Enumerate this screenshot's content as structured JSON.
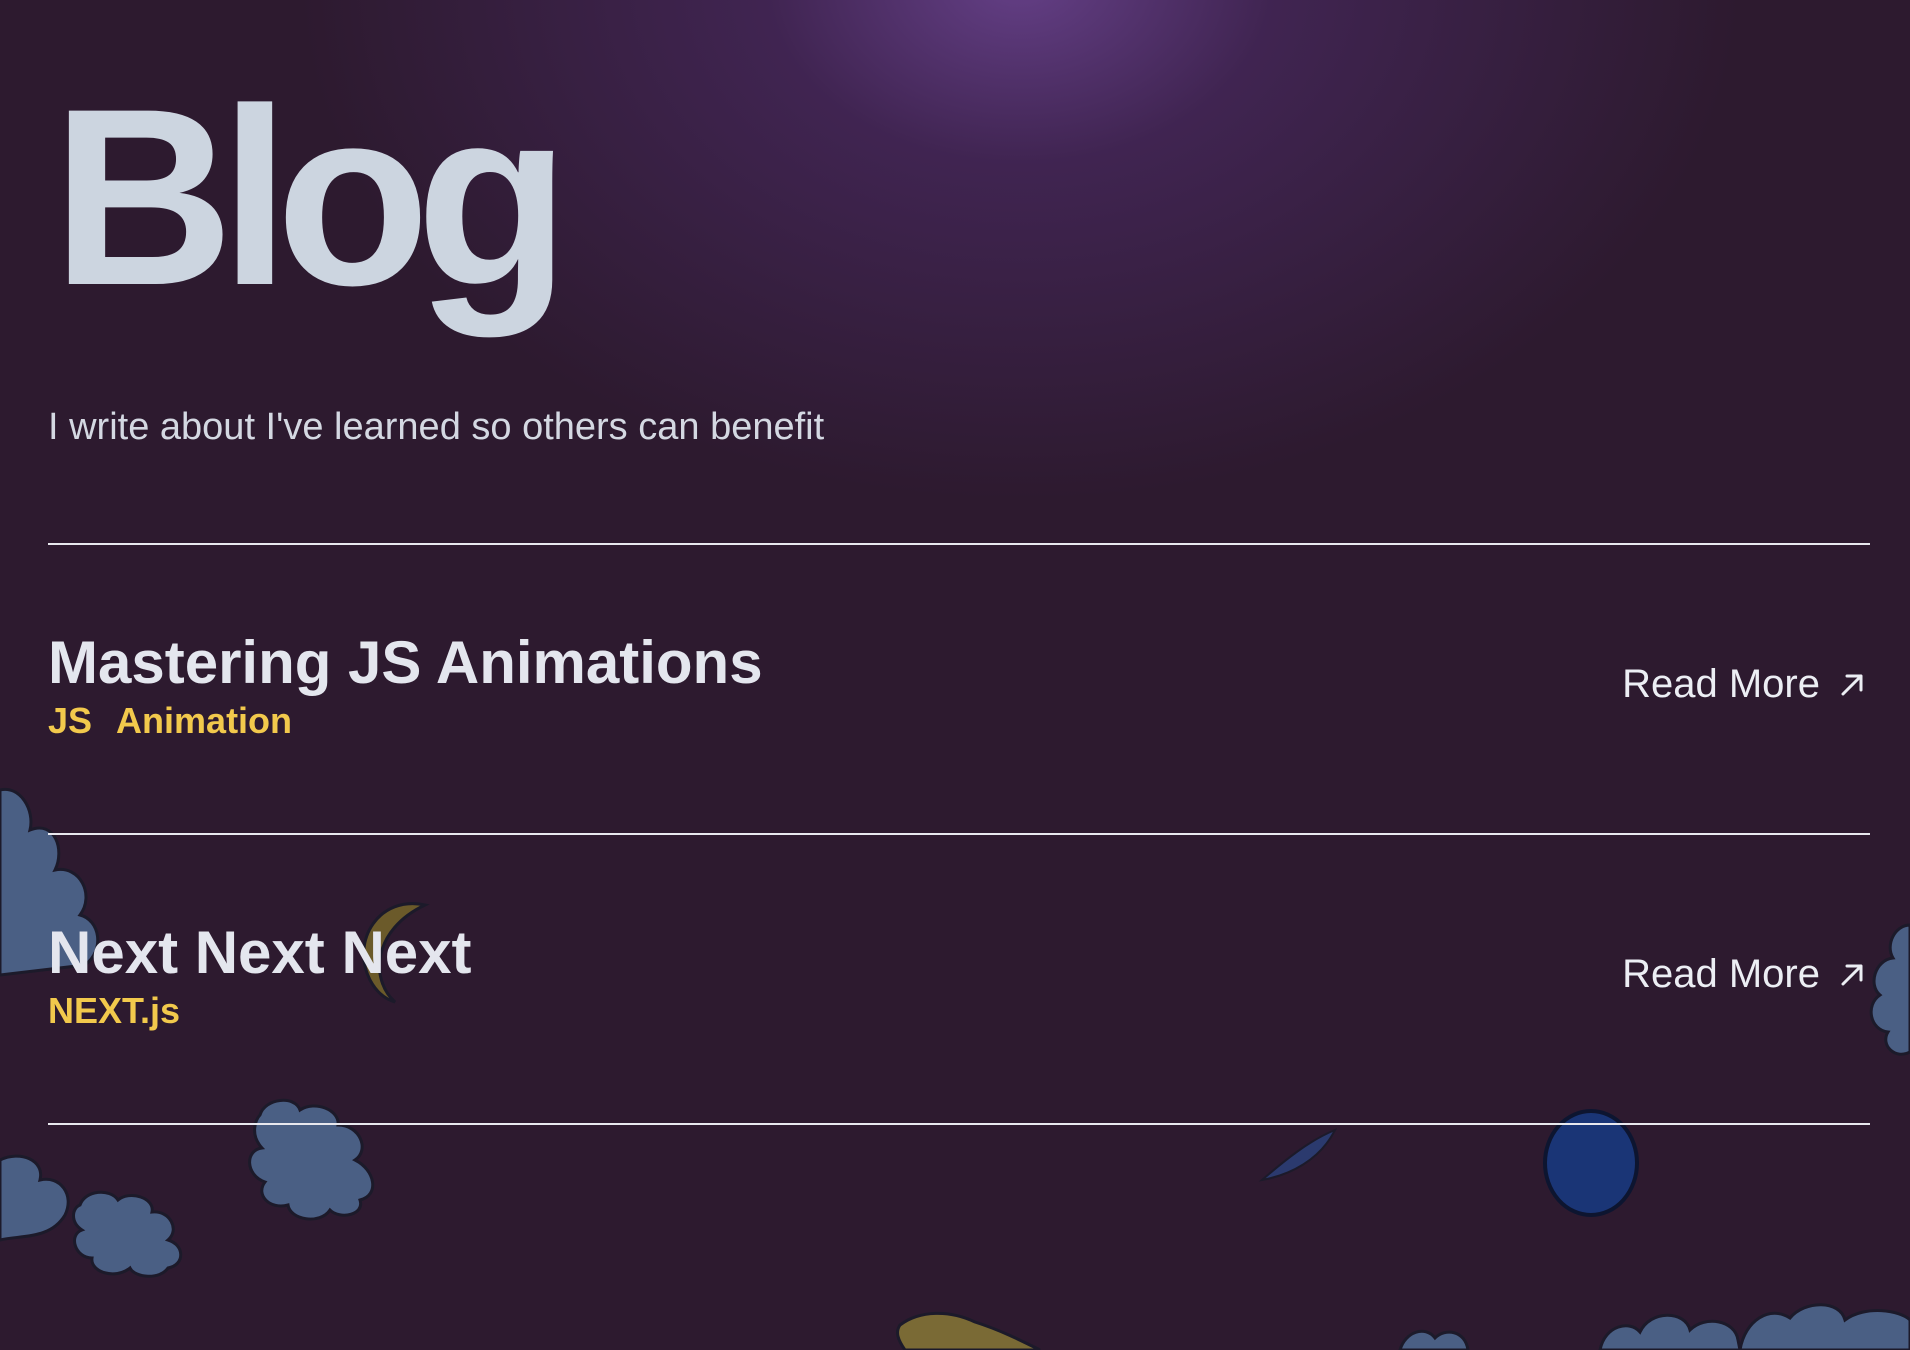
{
  "page": {
    "title": "Blog",
    "subtitle": "I write about I've learned so others can benefit"
  },
  "posts": [
    {
      "title": "Mastering JS Animations",
      "tags": [
        "JS",
        "Animation"
      ],
      "read_more_label": "Read More"
    },
    {
      "title": "Next Next Next",
      "tags": [
        "NEXT.js"
      ],
      "read_more_label": "Read More"
    }
  ],
  "colors": {
    "background": "#2d1a2f",
    "glow": "#6e4696",
    "title": "#ccd5e0",
    "tag": "#f2c94c",
    "divider": "#e8e8ee"
  },
  "icons": {
    "read_more": "arrow-up-right-icon"
  }
}
